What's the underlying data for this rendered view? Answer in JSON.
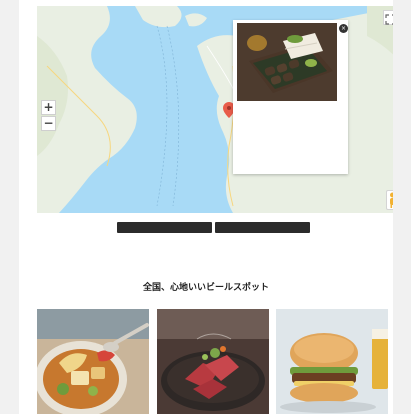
{
  "map": {
    "zoom_in_label": "+",
    "zoom_out_label": "−",
    "attribution": "",
    "place_labels": [
      "",
      ""
    ],
    "water_color": "#a8daf6",
    "land_color": "#e9efe3",
    "pin_color": "#e85c4a"
  },
  "popup": {
    "close_label": "×",
    "title": "",
    "description": "",
    "more_label": ""
  },
  "nav": {
    "prev_label": "",
    "next_label": ""
  },
  "section": {
    "eyebrow": "",
    "title": "全国、心地いいビールスポット",
    "accent_color": "#e2762e"
  },
  "cards": [
    {
      "image": "stew-with-vegetables-photo"
    },
    {
      "image": "seared-tuna-dish-photo"
    },
    {
      "image": "burger-and-beer-photo"
    }
  ]
}
